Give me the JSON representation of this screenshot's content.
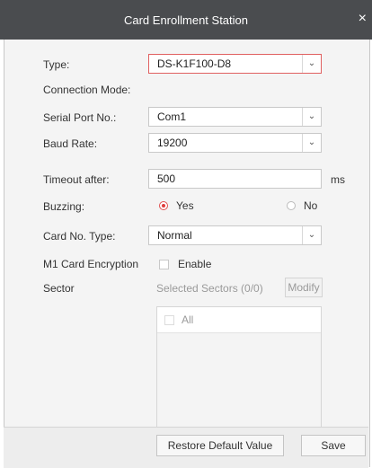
{
  "window": {
    "title": "Card Enrollment Station",
    "close_icon": "close-icon"
  },
  "form": {
    "type": {
      "label": "Type:",
      "value": "DS-K1F100-D8"
    },
    "connection_mode": {
      "label": "Connection Mode:"
    },
    "serial_port": {
      "label": "Serial Port No.:",
      "value": "Com1"
    },
    "baud_rate": {
      "label": "Baud Rate:",
      "value": "19200"
    },
    "timeout": {
      "label": "Timeout after:",
      "value": "500",
      "unit": "ms"
    },
    "buzzing": {
      "label": "Buzzing:",
      "yes": "Yes",
      "no": "No",
      "selected": "Yes"
    },
    "card_no_type": {
      "label": "Card No. Type:",
      "value": "Normal"
    },
    "m1_encryption": {
      "label": "M1 Card Encryption",
      "checkbox_label": "Enable",
      "checked": false
    },
    "sector": {
      "label": "Sector",
      "selected_text": "Selected Sectors (0/0)",
      "modify_label": "Modify",
      "all_label": "All"
    }
  },
  "footer": {
    "restore_label": "Restore Default Value",
    "save_label": "Save"
  },
  "colors": {
    "accent": "#e03c3c",
    "titlebar": "#4a4c4f"
  }
}
